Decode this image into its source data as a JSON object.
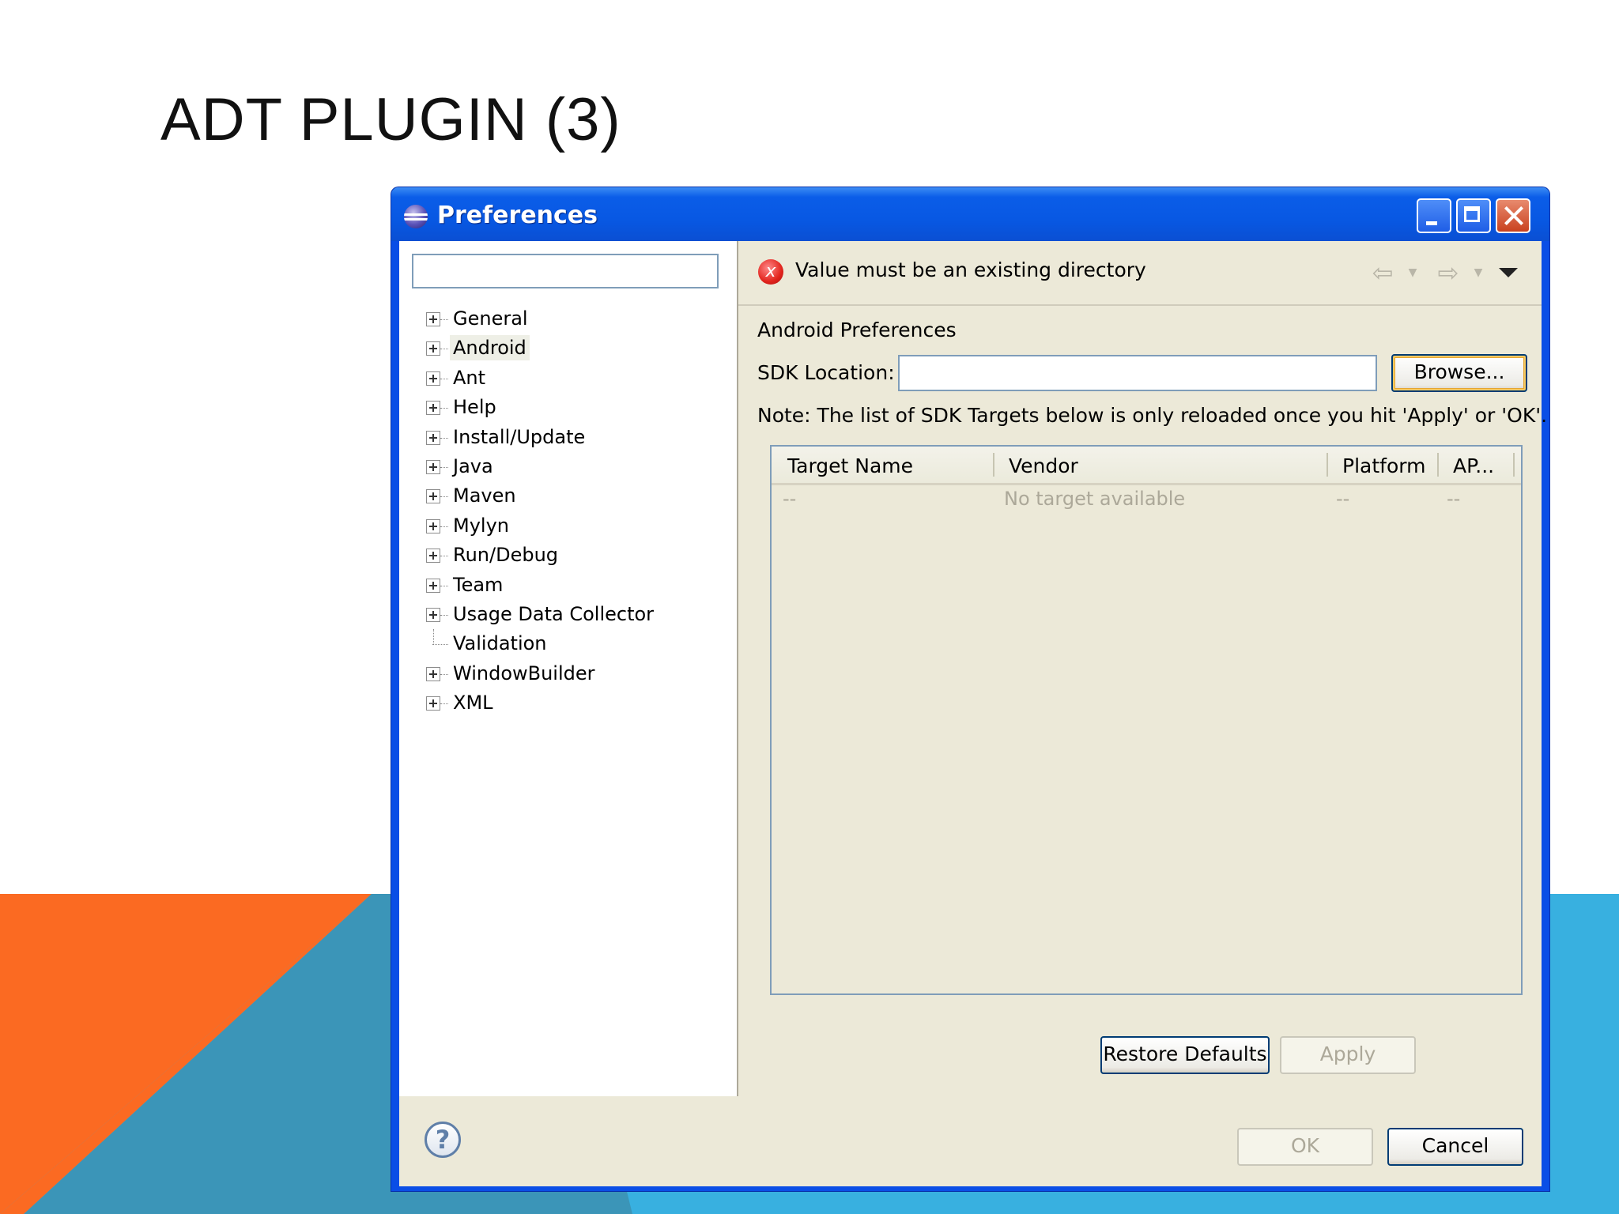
{
  "slide": {
    "title": "ADT PLUGIN (3)"
  },
  "window": {
    "title": "Preferences"
  },
  "filter": {
    "value": ""
  },
  "tree": {
    "items": [
      {
        "label": "General",
        "expandable": true
      },
      {
        "label": "Android",
        "expandable": true,
        "selected": true
      },
      {
        "label": "Ant",
        "expandable": true
      },
      {
        "label": "Help",
        "expandable": true
      },
      {
        "label": "Install/Update",
        "expandable": true
      },
      {
        "label": "Java",
        "expandable": true
      },
      {
        "label": "Maven",
        "expandable": true
      },
      {
        "label": "Mylyn",
        "expandable": true
      },
      {
        "label": "Run/Debug",
        "expandable": true
      },
      {
        "label": "Team",
        "expandable": true
      },
      {
        "label": "Usage Data Collector",
        "expandable": true
      },
      {
        "label": "Validation",
        "expandable": false
      },
      {
        "label": "WindowBuilder",
        "expandable": true
      },
      {
        "label": "XML",
        "expandable": true
      }
    ]
  },
  "message": {
    "text": "Value must be an existing directory",
    "icon": "error-icon"
  },
  "page": {
    "section_title": "Android Preferences",
    "sdk_label": "SDK Location:",
    "sdk_value": "",
    "browse_label": "Browse...",
    "note": "Note: The list of SDK Targets below is only reloaded once you hit 'Apply' or 'OK'."
  },
  "table": {
    "columns": [
      "Target Name",
      "Vendor",
      "Platform",
      "AP..."
    ],
    "rows": [
      [
        "--",
        "No target available",
        "--",
        "--"
      ]
    ]
  },
  "buttons": {
    "restore_defaults": "Restore Defaults",
    "apply": "Apply",
    "ok": "OK",
    "cancel": "Cancel"
  },
  "colors": {
    "titlebar": "#0858e3",
    "dialog_bg": "#ece9d8",
    "deco_orange": "#fb6a22",
    "deco_blue": "#3b95b8",
    "deco_cyan": "#38b0e0"
  }
}
